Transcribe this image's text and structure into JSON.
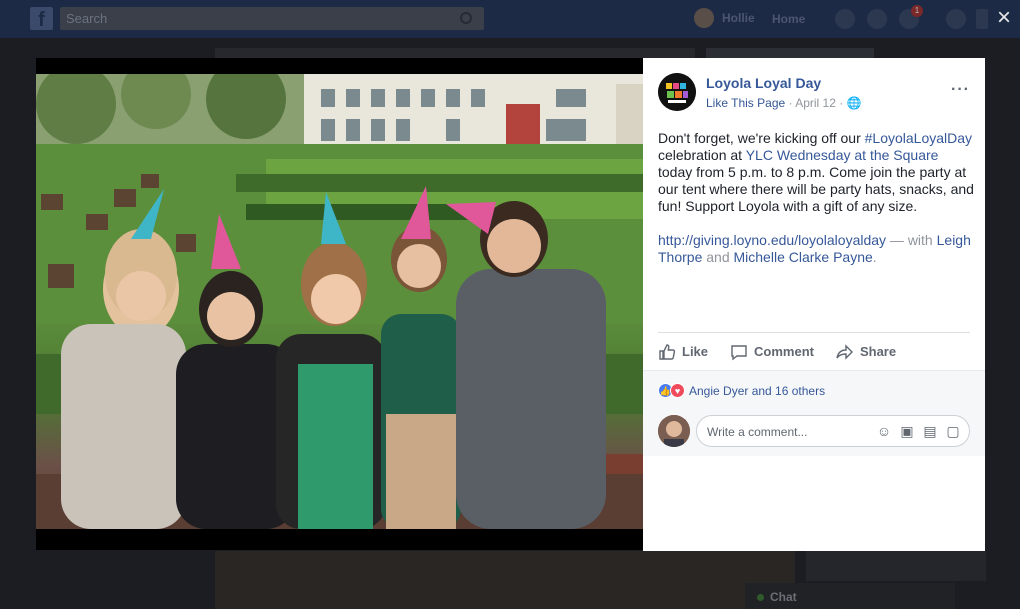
{
  "topbar": {
    "search_placeholder": "Search",
    "user_name": "Hollie",
    "home_label": "Home",
    "notifications_count": "1"
  },
  "lightbox": {
    "close_icon": "×"
  },
  "post": {
    "page_name": "Loyola Loyal Day",
    "like_page_label": "Like This Page",
    "date": "April 12",
    "privacy_icon": "globe-icon",
    "more_label": "···",
    "body": {
      "p1_a": "Don't forget, we're kicking off our ",
      "hashtag": "#LoyolaLoyalDay",
      "p1_b": " celebration at ",
      "venue": "YLC Wednesday at the Square",
      "p1_c": " today from 5 p.m. to 8 p.m. Come join the party at our tent where there will be party hats, snacks, and fun! Support Loyola with a gift of any size.",
      "link": "http://giving.loyno.edu/loyolaloyalday",
      "with_text": " — with ",
      "person1": "Leigh Thorpe",
      "and_text": " and ",
      "person2": "Michelle Clarke Payne",
      "period": "."
    },
    "actions": {
      "like": "Like",
      "comment": "Comment",
      "share": "Share"
    },
    "reactions_text": "Angie Dyer and 16 others",
    "comment_placeholder": "Write a comment..."
  },
  "chat": {
    "label": "Chat"
  },
  "colors": {
    "link": "#365899",
    "topbar": "#1d2a45"
  }
}
